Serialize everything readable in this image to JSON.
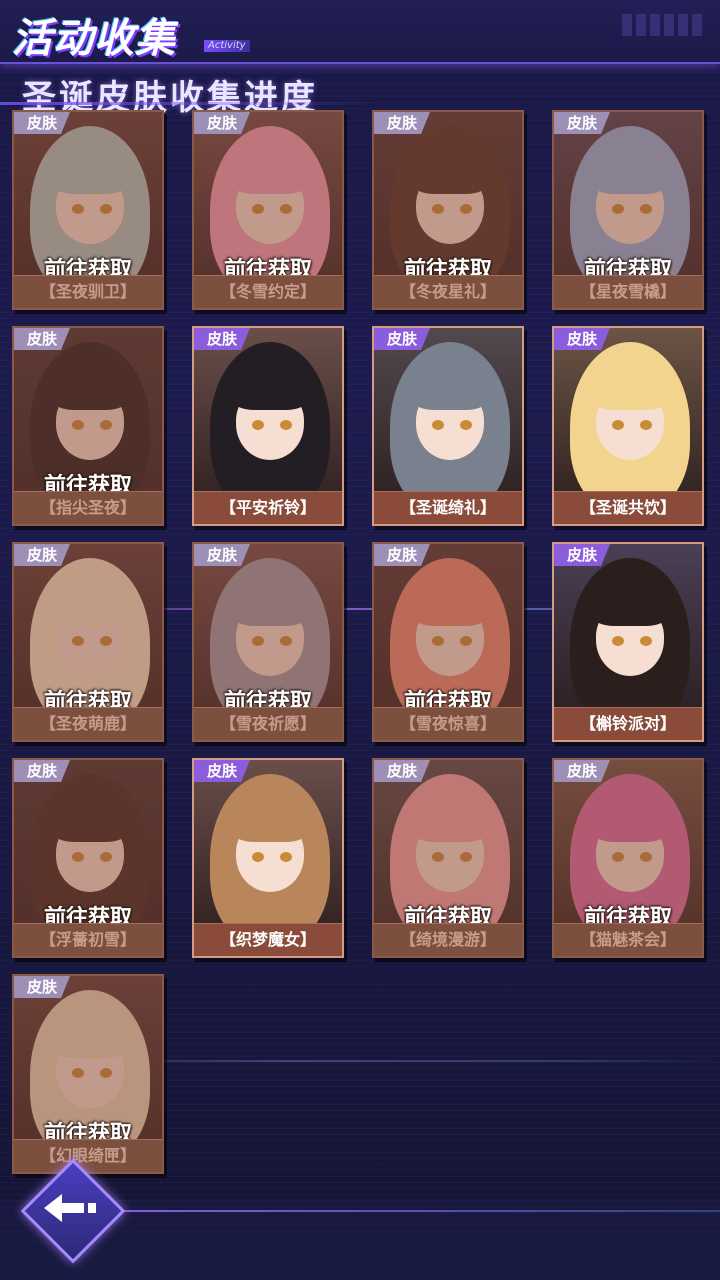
{
  "header": {
    "title": "活动收集",
    "subtitle": "Activity"
  },
  "section": {
    "title": "圣诞皮肤收集进度"
  },
  "colors": {
    "accent": "#8b5ddc",
    "card_border": "#8a5a47",
    "name_bar": "#7d4f3e"
  },
  "cards": [
    {
      "tag": "皮肤",
      "action": "前往获取",
      "name": "【圣夜驯卫】",
      "owned": false,
      "hair": "#a9c3c0"
    },
    {
      "tag": "皮肤",
      "action": "前往获取",
      "name": "【冬雪约定】",
      "owned": false,
      "hair": "#ee9cb3"
    },
    {
      "tag": "皮肤",
      "action": "前往获取",
      "name": "【冬夜星礼】",
      "owned": false,
      "hair": "#4b3028"
    },
    {
      "tag": "皮肤",
      "action": "前往获取",
      "name": "【星夜雪橇】",
      "owned": false,
      "hair": "#8fb1dc"
    },
    {
      "tag": "皮肤",
      "action": "前往获取",
      "name": "【指尖圣夜】",
      "owned": false,
      "hair": "#221a1c"
    },
    {
      "tag": "皮肤",
      "action": "",
      "name": "【平安祈铃】",
      "owned": true,
      "hair": "#231d24"
    },
    {
      "tag": "皮肤",
      "action": "",
      "name": "【圣诞绮礼】",
      "owned": true,
      "hair": "#79808e"
    },
    {
      "tag": "皮肤",
      "action": "",
      "name": "【圣诞共饮】",
      "owned": true,
      "hair": "#f3d48e"
    },
    {
      "tag": "皮肤",
      "action": "前往获取",
      "name": "【圣夜萌鹿】",
      "owned": false,
      "hair": "#f2e2c4"
    },
    {
      "tag": "皮肤",
      "action": "前往获取",
      "name": "【雪夜祈愿】",
      "owned": false,
      "hair": "#9c9aa8"
    },
    {
      "tag": "皮肤",
      "action": "前往获取",
      "name": "【雪夜惊喜】",
      "owned": false,
      "hair": "#e98873"
    },
    {
      "tag": "皮肤",
      "action": "",
      "name": "【槲铃派对】",
      "owned": true,
      "hair": "#2a1f1c"
    },
    {
      "tag": "皮肤",
      "action": "前往获取",
      "name": "【浮薔初雪】",
      "owned": false,
      "hair": "#3b2721"
    },
    {
      "tag": "皮肤",
      "action": "",
      "name": "【织梦魔女】",
      "owned": true,
      "hair": "#b8865a"
    },
    {
      "tag": "皮肤",
      "action": "前往获取",
      "name": "【绮境漫游】",
      "owned": false,
      "hair": "#f2a0a8"
    },
    {
      "tag": "皮肤",
      "action": "前往获取",
      "name": "【猫魅茶会】",
      "owned": false,
      "hair": "#d86aa0"
    },
    {
      "tag": "皮肤",
      "action": "前往获取",
      "name": "【幻眼绮匣】",
      "owned": false,
      "hair": "#e8d6b8"
    }
  ]
}
